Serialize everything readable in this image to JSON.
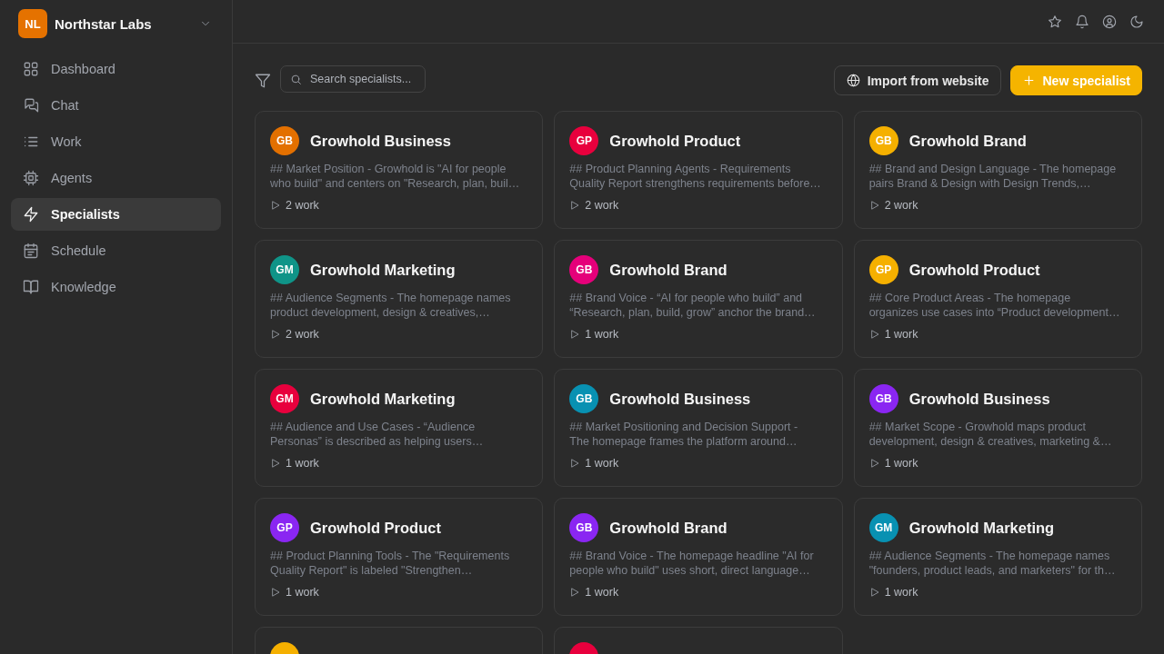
{
  "sidebar": {
    "org": {
      "initials": "NL",
      "name": "Northstar Labs"
    },
    "items": [
      {
        "label": "Dashboard",
        "selected": false
      },
      {
        "label": "Chat",
        "selected": false
      },
      {
        "label": "Work",
        "selected": false
      },
      {
        "label": "Agents",
        "selected": false
      },
      {
        "label": "Specialists",
        "selected": true
      },
      {
        "label": "Schedule",
        "selected": false
      },
      {
        "label": "Knowledge",
        "selected": false
      }
    ]
  },
  "toolbar": {
    "search": {
      "placeholder": "Search specialists..."
    },
    "buttons": [
      {
        "label": "Import from website",
        "kind": "secondary"
      },
      {
        "label": "New specialist",
        "kind": "primary"
      }
    ]
  },
  "cards": [
    {
      "initials": "GB",
      "color": "#e37000",
      "title": "Growhold Business",
      "description": "## Market Position - Growhold is \"AI for people\nwho build\" and centers on \"Research, plan, buil…",
      "work": "2 work"
    },
    {
      "initials": "GP",
      "color": "#e8003d",
      "title": "Growhold Product",
      "description": "## Product Planning Agents - Requirements\nQuality Report strengthens requirements before…",
      "work": "2 work"
    },
    {
      "initials": "GB",
      "color": "#f5b000",
      "title": "Growhold Brand",
      "description": "## Brand and Design Language - The homepage\npairs Brand & Design with Design Trends,…",
      "work": "2 work"
    },
    {
      "initials": "GM",
      "color": "#0f9488",
      "title": "Growhold Marketing",
      "description": "## Audience Segments - The homepage names\nproduct development, design & creatives,…",
      "work": "2 work"
    },
    {
      "initials": "GB",
      "color": "#e5007a",
      "title": "Growhold Brand",
      "description": "## Brand Voice - “AI for people who build” and\n“Research, plan, build, grow” anchor the brand…",
      "work": "1 work"
    },
    {
      "initials": "GP",
      "color": "#f5b000",
      "title": "Growhold Product",
      "description": "## Core Product Areas - The homepage\norganizes use cases into “Product development…",
      "work": "1 work"
    },
    {
      "initials": "GM",
      "color": "#e8003d",
      "title": "Growhold Marketing",
      "description": "## Audience and Use Cases - “Audience\nPersonas” is described as helping users…",
      "work": "1 work"
    },
    {
      "initials": "GB",
      "color": "#0891b2",
      "title": "Growhold Business",
      "description": "## Market Positioning and Decision Support -\nThe homepage frames the platform around…",
      "work": "1 work"
    },
    {
      "initials": "GB",
      "color": "#8a26f2",
      "title": "Growhold Business",
      "description": "## Market Scope - Growhold maps product\ndevelopment, design & creatives, marketing &…",
      "work": "1 work"
    },
    {
      "initials": "GP",
      "color": "#8a26f2",
      "title": "Growhold Product",
      "description": "## Product Planning Tools - The \"Requirements\nQuality Report\" is labeled \"Strengthen…",
      "work": "1 work"
    },
    {
      "initials": "GB",
      "color": "#8a26f2",
      "title": "Growhold Brand",
      "description": "## Brand Voice - The homepage headline \"AI for\npeople who build\" uses short, direct language…",
      "work": "1 work"
    },
    {
      "initials": "GM",
      "color": "#0891b2",
      "title": "Growhold Marketing",
      "description": "## Audience Segments - The homepage names\n\"founders, product leads, and marketers\" for th…",
      "work": "1 work"
    },
    {
      "color": "#f5b000"
    },
    {
      "color": "#e8003d"
    }
  ]
}
